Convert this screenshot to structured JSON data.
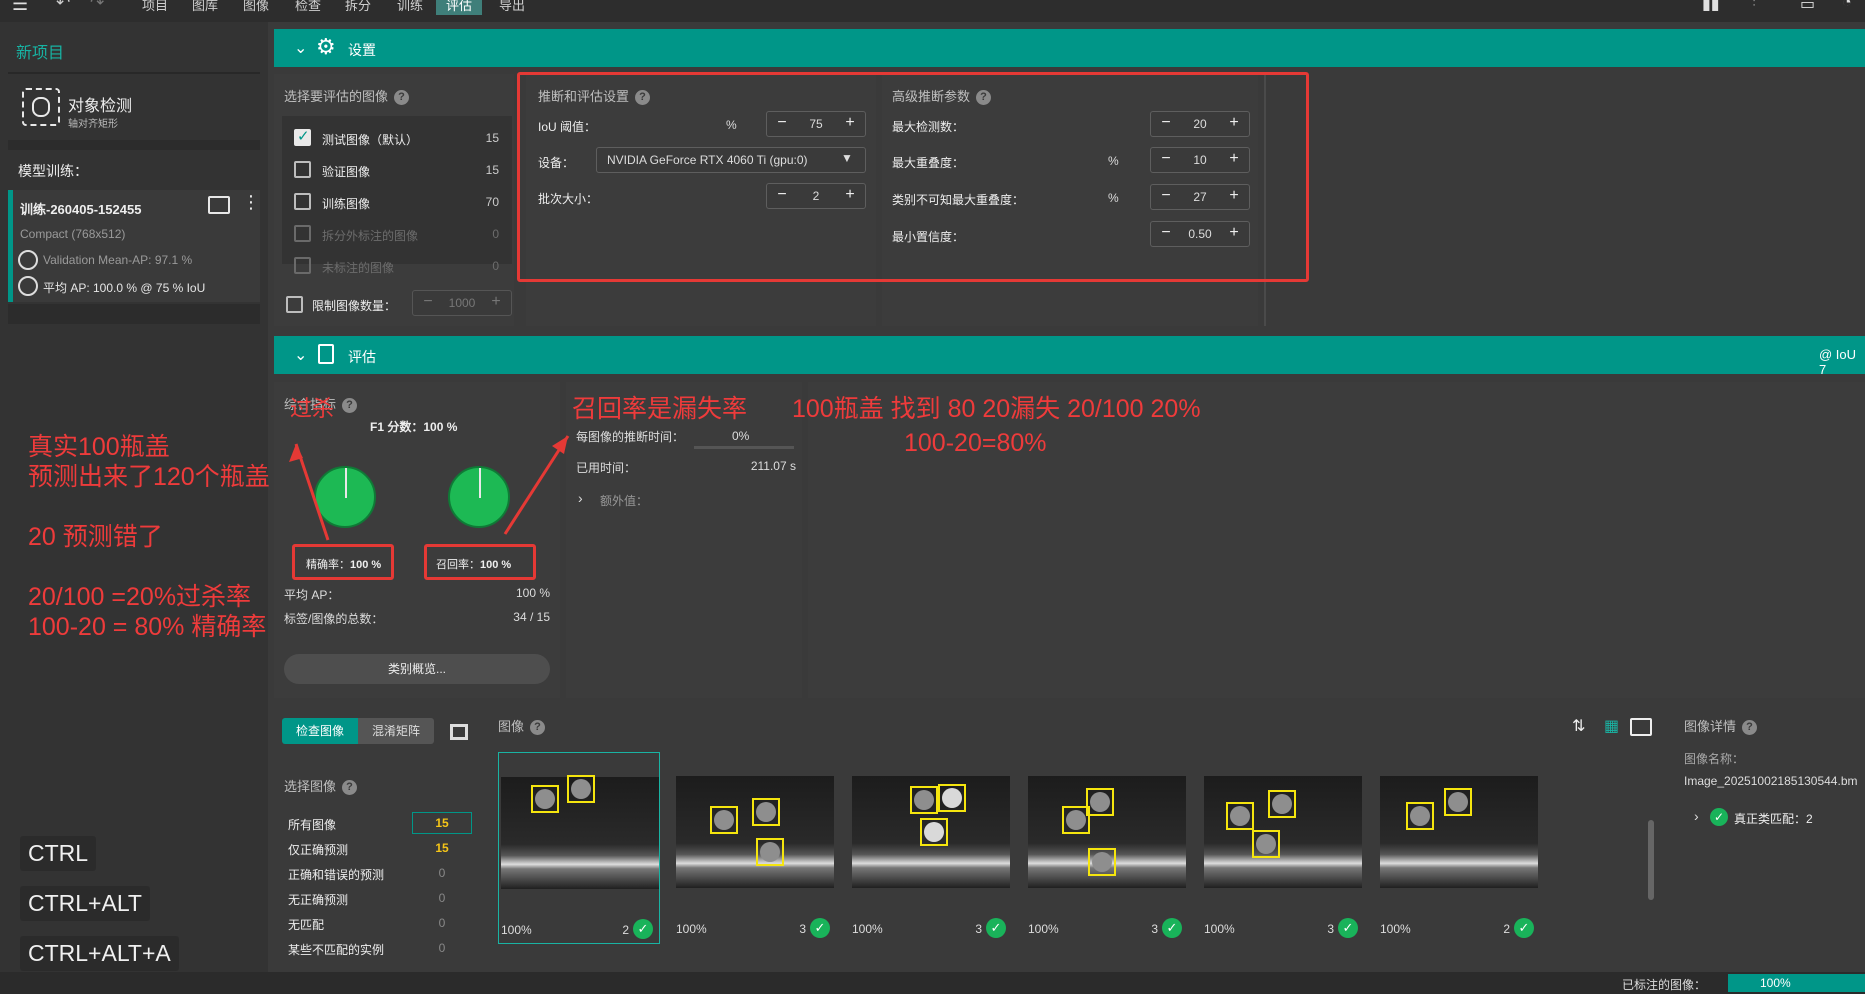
{
  "menubar": {
    "items": [
      "项目",
      "图库",
      "图像",
      "检查",
      "拆分",
      "训练",
      "评估",
      "导出"
    ],
    "active": "评估"
  },
  "sidebar": {
    "project_name": "新项目",
    "task_title": "对象检测",
    "task_subtitle": "轴对齐矩形",
    "model_training_label": "模型训练：",
    "training_name": "训练-260405-152455",
    "training_model": "Compact (768x512)",
    "validation_map": "Validation Mean-AP: 97.1 %",
    "average_ap": "平均 AP: 100.0 % @ 75 % IoU"
  },
  "settings_header": {
    "title": "设置"
  },
  "eval_header": {
    "title": "评估",
    "right_text": "@ IoU 7"
  },
  "image_select": {
    "title": "选择要评估的图像",
    "options": [
      {
        "label": "测试图像（默认）",
        "count": "15",
        "checked": true,
        "disabled": false
      },
      {
        "label": "验证图像",
        "count": "15",
        "checked": false,
        "disabled": false
      },
      {
        "label": "训练图像",
        "count": "70",
        "checked": false,
        "disabled": false
      },
      {
        "label": "拆分外标注的图像",
        "count": "0",
        "checked": false,
        "disabled": true
      },
      {
        "label": "未标注的图像",
        "count": "0",
        "checked": false,
        "disabled": true
      }
    ],
    "limit_label": "限制图像数量：",
    "limit_value": "1000"
  },
  "inference": {
    "title": "推断和评估设置",
    "iou_label": "IoU 阈值：",
    "iou_unit": "%",
    "iou_value": "75",
    "device_label": "设备：",
    "device_value": "NVIDIA GeForce RTX 4060 Ti (gpu:0)",
    "batch_label": "批次大小：",
    "batch_value": "2"
  },
  "advanced": {
    "title": "高级推断参数",
    "max_det_label": "最大检测数：",
    "max_det_value": "20",
    "max_overlap_label": "最大重叠度：",
    "max_overlap_unit": "%",
    "max_overlap_value": "10",
    "class_agnostic_label": "类别不可知最大重叠度：",
    "class_agnostic_unit": "%",
    "class_agnostic_value": "27",
    "min_conf_label": "最小置信度：",
    "min_conf_value": "0.50"
  },
  "metrics": {
    "title": "综合指标",
    "f1_label": "F1 分数：",
    "f1_value": "100 %",
    "precision_label": "精确率：",
    "precision_value": "100 %",
    "precision_fraction": 1.0,
    "recall_label": "召回率：",
    "recall_value": "100 %",
    "recall_fraction": 1.0,
    "avg_ap_label": "平均 AP：",
    "avg_ap_value": "100 %",
    "label_image_total_label": "标签/图像的总数：",
    "label_image_total_value": "34 / 15",
    "class_overview_button": "类别概览..."
  },
  "timing": {
    "per_image_label": "每图像的推断时间：",
    "per_image_value": "0%",
    "elapsed_label": "已用时间：",
    "elapsed_value": "211.07 s",
    "extra_label": "额外值："
  },
  "annotations": {
    "overkill": "过杀",
    "recall_note": "召回率是漏失率",
    "example_line1": "100瓶盖   找到 80   20漏失   20/100 20%",
    "example_line2": "100-20=80%",
    "left_lines": [
      "真实100瓶盖",
      "预测出来了120个瓶盖",
      "",
      "20 预测错了",
      "",
      "20/100 =20%过杀率",
      "100-20 = 80% 精确率"
    ]
  },
  "bottom_left": {
    "tab_inspect": "检查图像",
    "tab_confusion": "混淆矩阵",
    "select_title": "选择图像",
    "filters": [
      {
        "label": "所有图像",
        "count": "15",
        "highlight": true
      },
      {
        "label": "仅正确预测",
        "count": "15",
        "highlight": true
      },
      {
        "label": "正确和错误的预测",
        "count": "0",
        "highlight": false
      },
      {
        "label": "无正确预测",
        "count": "0",
        "highlight": false
      },
      {
        "label": "无匹配",
        "count": "0",
        "highlight": false
      },
      {
        "label": "某些不匹配的实例",
        "count": "0",
        "highlight": false
      }
    ]
  },
  "keyboard_overlay": [
    "CTRL",
    "CTRL+ALT",
    "CTRL+ALT+A"
  ],
  "gallery": {
    "title": "图像",
    "thumbnails": [
      {
        "pct": "100%",
        "count": "2"
      },
      {
        "pct": "100%",
        "count": "3"
      },
      {
        "pct": "100%",
        "count": "3"
      },
      {
        "pct": "100%",
        "count": "3"
      },
      {
        "pct": "100%",
        "count": "3"
      },
      {
        "pct": "100%",
        "count": "2"
      }
    ]
  },
  "details": {
    "title": "图像详情",
    "name_label": "图像名称：",
    "name_value": "Image_20251002185130544.bm",
    "tp_match": "真正类匹配：2"
  },
  "statusbar": {
    "labeled_label": "已标注的图像：",
    "labeled_value": "100%"
  },
  "colors": {
    "teal": "#009688",
    "annotation_red": "#e53935",
    "success_green": "#1db954",
    "highlight_yellow": "#f5c518"
  }
}
